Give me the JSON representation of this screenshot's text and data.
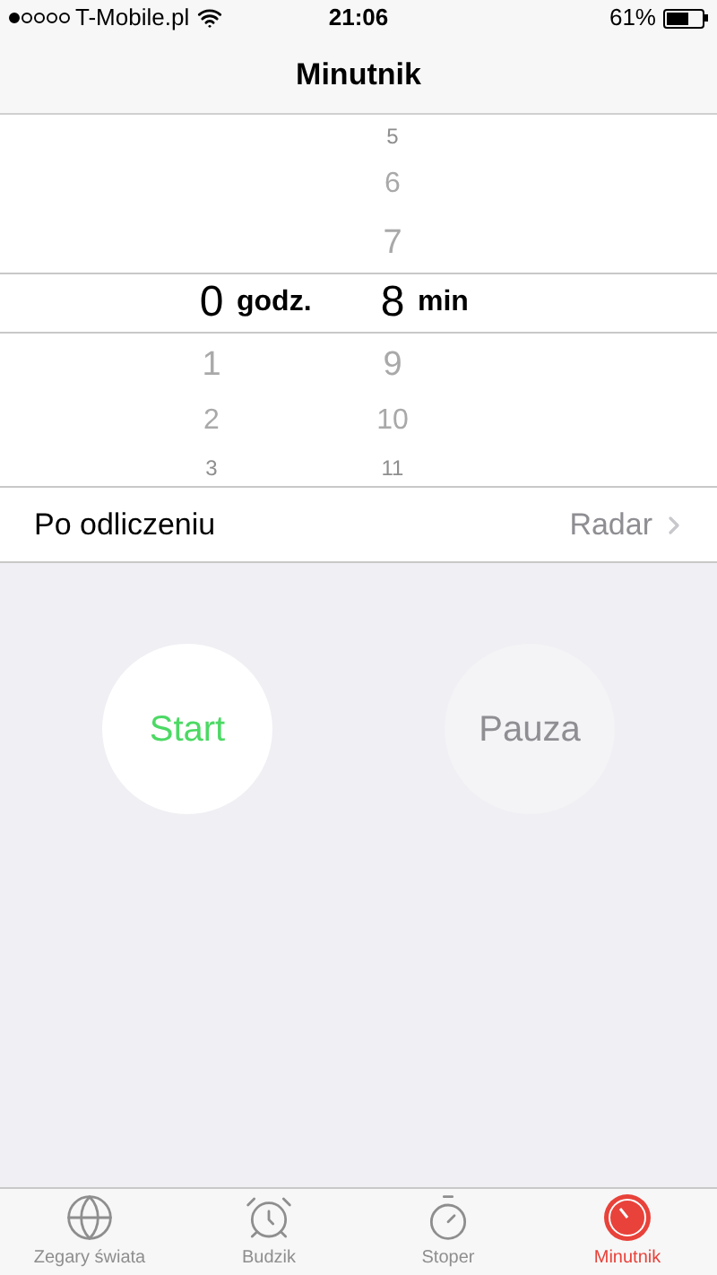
{
  "status_bar": {
    "carrier": "T-Mobile.pl",
    "time": "21:06",
    "battery": "61%"
  },
  "nav_bar": {
    "title": "Minutnik"
  },
  "picker": {
    "columns": [
      {
        "selected": "0",
        "unit": "godz.",
        "below": [
          "1",
          "2",
          "3"
        ]
      },
      {
        "above": [
          "5",
          "6",
          "7"
        ],
        "selected": "8",
        "unit": "min",
        "below": [
          "9",
          "10",
          "11"
        ]
      }
    ]
  },
  "row": {
    "label": "Po odliczeniu",
    "value": "Radar"
  },
  "buttons": [
    {
      "label": "Start",
      "disabled": false
    },
    {
      "label": "Pauza",
      "disabled": true
    }
  ],
  "tab_bar": [
    {
      "kind": "globe",
      "label": "Zegary świata",
      "selected": false
    },
    {
      "kind": "alarm",
      "label": "Budzik",
      "selected": false
    },
    {
      "kind": "stopwatch",
      "label": "Stoper",
      "selected": false
    },
    {
      "kind": "timer",
      "label": "Minutnik",
      "selected": true
    }
  ]
}
